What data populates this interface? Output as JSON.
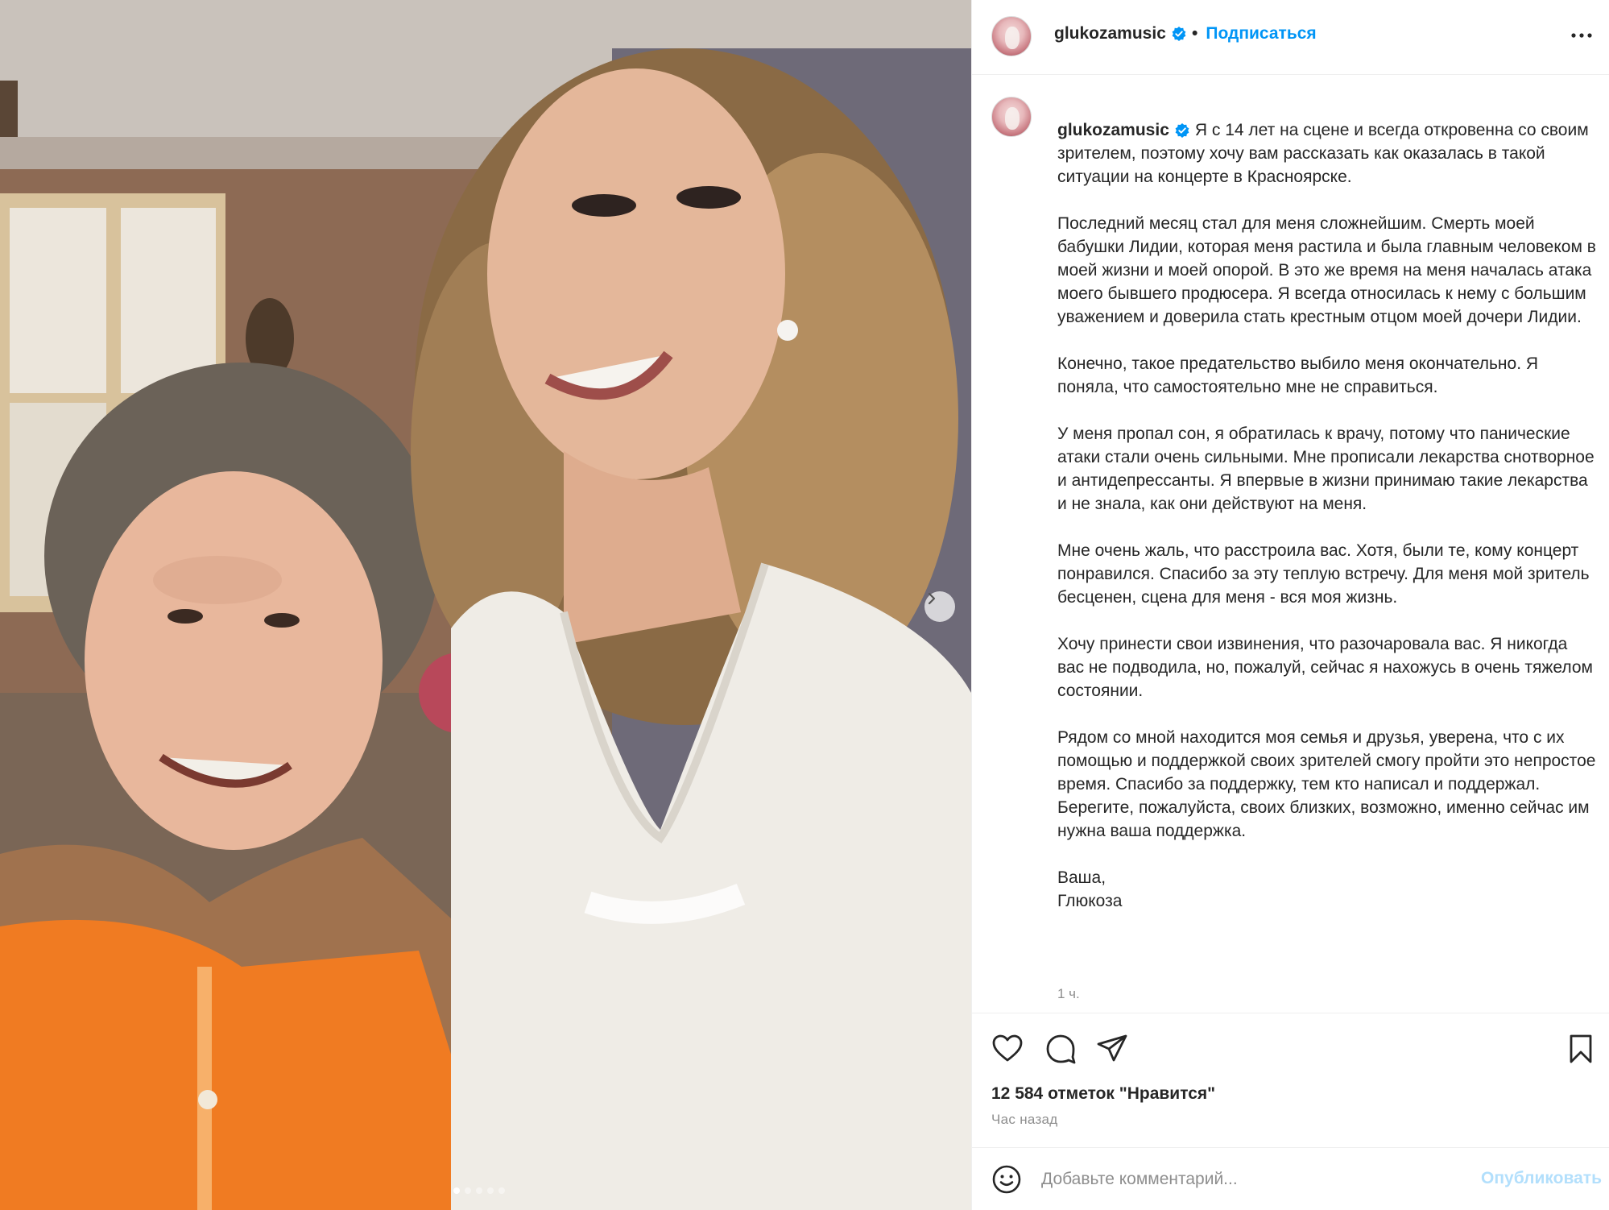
{
  "post": {
    "username": "glukozamusic",
    "follow_label": "Подписаться",
    "bullet": "•",
    "caption_paragraphs": [
      "Я с 14 лет на сцене и всегда откровенна со своим зрителем, поэтому хочу вам рассказать как оказалась в такой ситуации на концерте в Красноярске.",
      "Последний месяц стал для меня сложнейшим. Смерть моей бабушки Лидии, которая меня растила и была главным человеком в моей жизни и моей опорой. В это же время на меня началась атака моего бывшего продюсера. Я всегда относилась к нему с большим уважением и доверила стать крестным отцом моей дочери Лидии.",
      "Конечно, такое предательство выбило меня окончательно. Я поняла, что самостоятельно мне не справиться.",
      "У меня пропал сон, я обратилась к врачу, потому что панические атаки стали очень сильными. Мне прописали лекарства снотворное и антидепрессанты. Я впервые в жизни принимаю такие лекарства и не знала, как они действуют на меня.",
      "Мне очень жаль, что расстроила вас. Хотя, были те, кому концерт понравился. Спасибо за эту теплую встречу. Для меня мой зритель бесценен, сцена для меня - вся моя жизнь.",
      "Хочу принести свои извинения, что разочаровала вас. Я никогда вас не подводила, но, пожалуй, сейчас я нахожусь в очень тяжелом состоянии.",
      "Рядом со мной находится моя семья и друзья, уверена, что с их помощью и поддержкой своих зрителей смогу пройти это непростое время. Спасибо за поддержку, тем кто написал и поддержал. Берегите, пожалуйста, своих близких, возможно, именно сейчас им нужна ваша поддержка."
    ],
    "signature": "Ваша,\nГлюкоза",
    "caption_time": "1 ч.",
    "likes": "12 584 отметок \"Нравится\"",
    "posted_ago": "Час назад"
  },
  "comment": {
    "placeholder": "Добавьте комментарий...",
    "post_label": "Опубликовать"
  },
  "carousel": {
    "count": 5,
    "active": 0
  },
  "icons": {
    "verified": "verified-badge-icon",
    "more": "more-horizontal-icon",
    "like": "heart-icon",
    "comment": "comment-bubble-icon",
    "share": "paper-plane-icon",
    "save": "bookmark-icon",
    "emoji": "smiley-icon",
    "next": "chevron-right-icon"
  },
  "colors": {
    "accent": "#0095f6",
    "verified": "#0095f6",
    "post_disabled": "#b2dffc",
    "muted": "#8e8e8e"
  }
}
